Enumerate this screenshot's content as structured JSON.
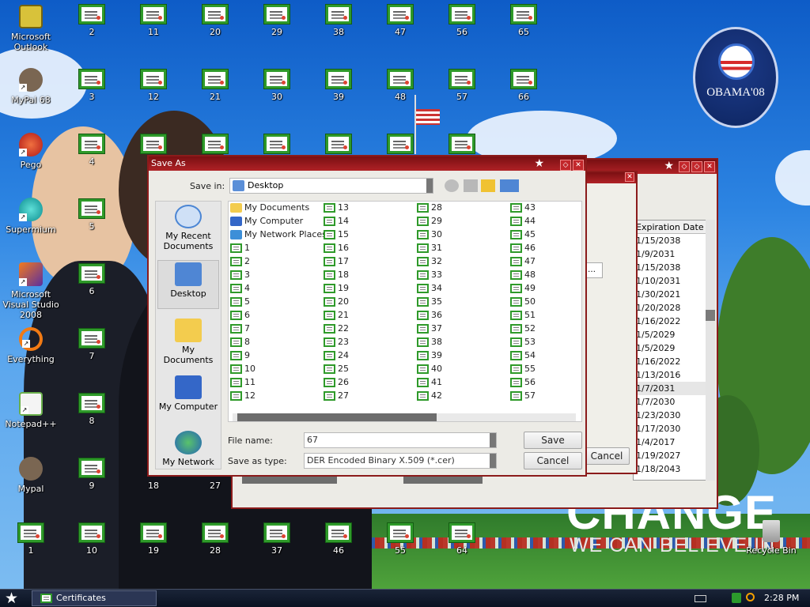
{
  "desktop": {
    "apps": [
      {
        "label": "Microsoft Outlook",
        "icon": "outlook-icon"
      },
      {
        "label": "MyPal 68",
        "icon": "mypal-raccoon-icon"
      },
      {
        "label": "Pego",
        "icon": "pego-icon"
      },
      {
        "label": "Supermium",
        "icon": "supermium-icon"
      },
      {
        "label": "Microsoft Visual Studio 2008",
        "icon": "visual-studio-icon"
      },
      {
        "label": "Everything",
        "icon": "everything-icon"
      },
      {
        "label": "Notepad++",
        "icon": "notepad-plus-icon"
      },
      {
        "label": "Mypal",
        "icon": "mypal-raccoon-icon"
      },
      {
        "label": "Recycle Bin",
        "icon": "recycle-bin-icon"
      }
    ],
    "cert_labels": {
      "c1": "1",
      "c2": "2",
      "c3": "3",
      "c4": "4",
      "c5": "5",
      "c6": "6",
      "c7": "7",
      "c8": "8",
      "c9": "9",
      "c10": "10",
      "c11": "11",
      "c12": "12",
      "c18": "18",
      "c19": "19",
      "c20": "20",
      "c21": "21",
      "c27": "27",
      "c28": "28",
      "c29": "29",
      "c30": "30",
      "c37": "37",
      "c38": "38",
      "c39": "39",
      "c46": "46",
      "c47": "47",
      "c48": "48",
      "c55": "55",
      "c56": "56",
      "c57": "57",
      "c64": "64",
      "c65": "65",
      "c66": "66"
    },
    "wallpaper": {
      "headline": "CHANGE",
      "subline": "WE CAN BELIEVE IN",
      "logo_text": "OBAMA'08"
    }
  },
  "background_window": {
    "column_header": "Expiration Date",
    "expiration_dates": [
      "1/15/2038",
      "1/9/2031",
      "1/15/2038",
      "1/10/2031",
      "1/30/2021",
      "1/20/2028",
      "1/16/2022",
      "1/5/2029",
      "1/5/2029",
      "1/16/2022",
      "1/13/2016",
      "1/7/2031",
      "1/7/2030",
      "1/23/2030",
      "1/17/2030",
      "1/4/2017",
      "1/19/2027",
      "1/18/2043"
    ],
    "partial_button": "Cancel"
  },
  "save_dialog": {
    "title": "Save As",
    "save_in_label": "Save in:",
    "save_in_value": "Desktop",
    "places": [
      {
        "label": "My Recent Documents",
        "icon": "recent-documents-icon"
      },
      {
        "label": "Desktop",
        "icon": "desktop-icon"
      },
      {
        "label": "My Documents",
        "icon": "my-documents-icon"
      },
      {
        "label": "My Computer",
        "icon": "my-computer-icon"
      },
      {
        "label": "My Network",
        "icon": "my-network-icon"
      }
    ],
    "special_items": [
      "My Documents",
      "My Computer",
      "My Network Places"
    ],
    "files": [
      "1",
      "2",
      "3",
      "4",
      "5",
      "6",
      "7",
      "8",
      "9",
      "10",
      "11",
      "12",
      "13",
      "14",
      "15",
      "16",
      "17",
      "18",
      "19",
      "20",
      "21",
      "22",
      "23",
      "24",
      "25",
      "26",
      "27",
      "28",
      "29",
      "30",
      "31",
      "32",
      "33",
      "34",
      "35",
      "36",
      "37",
      "38",
      "39",
      "40",
      "41",
      "42",
      "43",
      "44",
      "45",
      "46",
      "47",
      "48",
      "49",
      "50",
      "51",
      "52",
      "53",
      "54",
      "55",
      "56",
      "57"
    ],
    "file_name_label": "File name:",
    "file_name_value": "67",
    "save_type_label": "Save as type:",
    "save_type_value": "DER Encoded Binary X.509 (*.cer)",
    "save_button": "Save",
    "cancel_button": "Cancel"
  },
  "taskbar": {
    "task_label": "Certificates",
    "clock": "2:28 PM"
  }
}
